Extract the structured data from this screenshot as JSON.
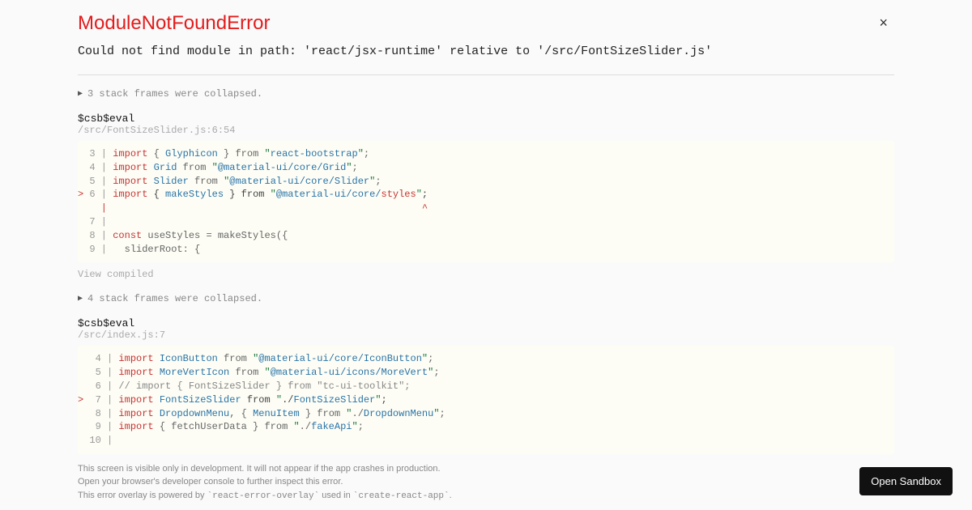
{
  "error": {
    "title": "ModuleNotFoundError",
    "message": "Could not find module in path: 'react/jsx-runtime' relative to '/src/FontSizeSlider.js'"
  },
  "close_label": "×",
  "collapse1": "3 stack frames were collapsed.",
  "collapse2": "4 stack frames were collapsed.",
  "triangle": "▶",
  "frame1": {
    "fn": "$csb$eval",
    "loc": "/src/FontSizeSlider.js:6:54"
  },
  "frame2": {
    "fn": "$csb$eval",
    "loc": "/src/index.js:7"
  },
  "view_compiled": "View compiled",
  "code1": {
    "l3": {
      "ln": "  3 | ",
      "kw": "import",
      "b1": " { ",
      "id": "Glyphicon",
      "b2": " } from ",
      "q1": "\"",
      "str": "react-bootstrap",
      "q2": "\"",
      "semi": ";"
    },
    "l4": {
      "ln": "  4 | ",
      "kw": "import",
      "sp": " ",
      "id": "Grid",
      "from": " from ",
      "q1": "\"",
      "str": "@material-ui/core/Grid",
      "q2": "\"",
      "semi": ";"
    },
    "l5": {
      "ln": "  5 | ",
      "kw": "import",
      "sp": " ",
      "id": "Slider",
      "from": " from ",
      "q1": "\"",
      "str": "@material-ui/core/Slider",
      "q2": "\"",
      "semi": ";"
    },
    "l6": {
      "gt": "> ",
      "ln": "6 | ",
      "kw": "import",
      "b1": " { ",
      "id": "makeStyles",
      "b2": " } from ",
      "q1": "\"",
      "str1": "@material-ui/core/",
      "str2": "styles",
      "q2": "\"",
      "semi": ";"
    },
    "caret": "    |                                                      ^",
    "l7": {
      "ln": "  7 | "
    },
    "l8": {
      "ln": "  8 | ",
      "kw": "const",
      "rest": " useStyles = makeStyles({"
    },
    "l9": {
      "ln": "  9 | ",
      "rest": "  sliderRoot: {"
    }
  },
  "code2": {
    "l4": {
      "ln": "   4 | ",
      "kw": "import",
      "sp": " ",
      "id": "IconButton",
      "from": " from ",
      "q1": "\"",
      "str": "@material-ui/core/IconButton",
      "q2": "\"",
      "semi": ";"
    },
    "l5": {
      "ln": "   5 | ",
      "kw": "import",
      "sp": " ",
      "id": "MoreVertIcon",
      "from": " from ",
      "q1": "\"",
      "str": "@material-ui/icons/MoreVert",
      "q2": "\"",
      "semi": ";"
    },
    "l6": {
      "ln": "   6 | ",
      "cmt": "// import { FontSizeSlider } from \"tc-ui-toolkit\";"
    },
    "l7": {
      "gt": ">  ",
      "ln": "7 | ",
      "kw": "import",
      "sp": " ",
      "id": "FontSizeSlider",
      "from": " from ",
      "q1": "\"",
      "str1": "./",
      "str2": "FontSizeSlider",
      "q2": "\"",
      "semi": ";"
    },
    "l8": {
      "ln": "   8 | ",
      "kw": "import",
      "sp": " ",
      "id1": "DropdownMenu",
      "comma": ", { ",
      "id2": "MenuItem",
      "b2": " } from ",
      "q1": "\"",
      "str1": "./",
      "str2": "DropdownMenu",
      "q2": "\"",
      "semi": ";"
    },
    "l9": {
      "ln": "   9 | ",
      "kw": "import",
      "b1": " { fetchUserData } from ",
      "q1": "\"",
      "str1": "./",
      "str2": "fakeApi",
      "q2": "\"",
      "semi": ";"
    },
    "l10": {
      "ln": "  10 | "
    }
  },
  "footer": {
    "line1": "This screen is visible only in development. It will not appear if the app crashes in production.",
    "line2": "Open your browser's developer console to further inspect this error.",
    "line3a": "This error overlay is powered by ",
    "line3b": "`react-error-overlay`",
    "line3c": " used in ",
    "line3d": "`create-react-app`",
    "line3e": "."
  },
  "sandbox_button": "Open Sandbox"
}
